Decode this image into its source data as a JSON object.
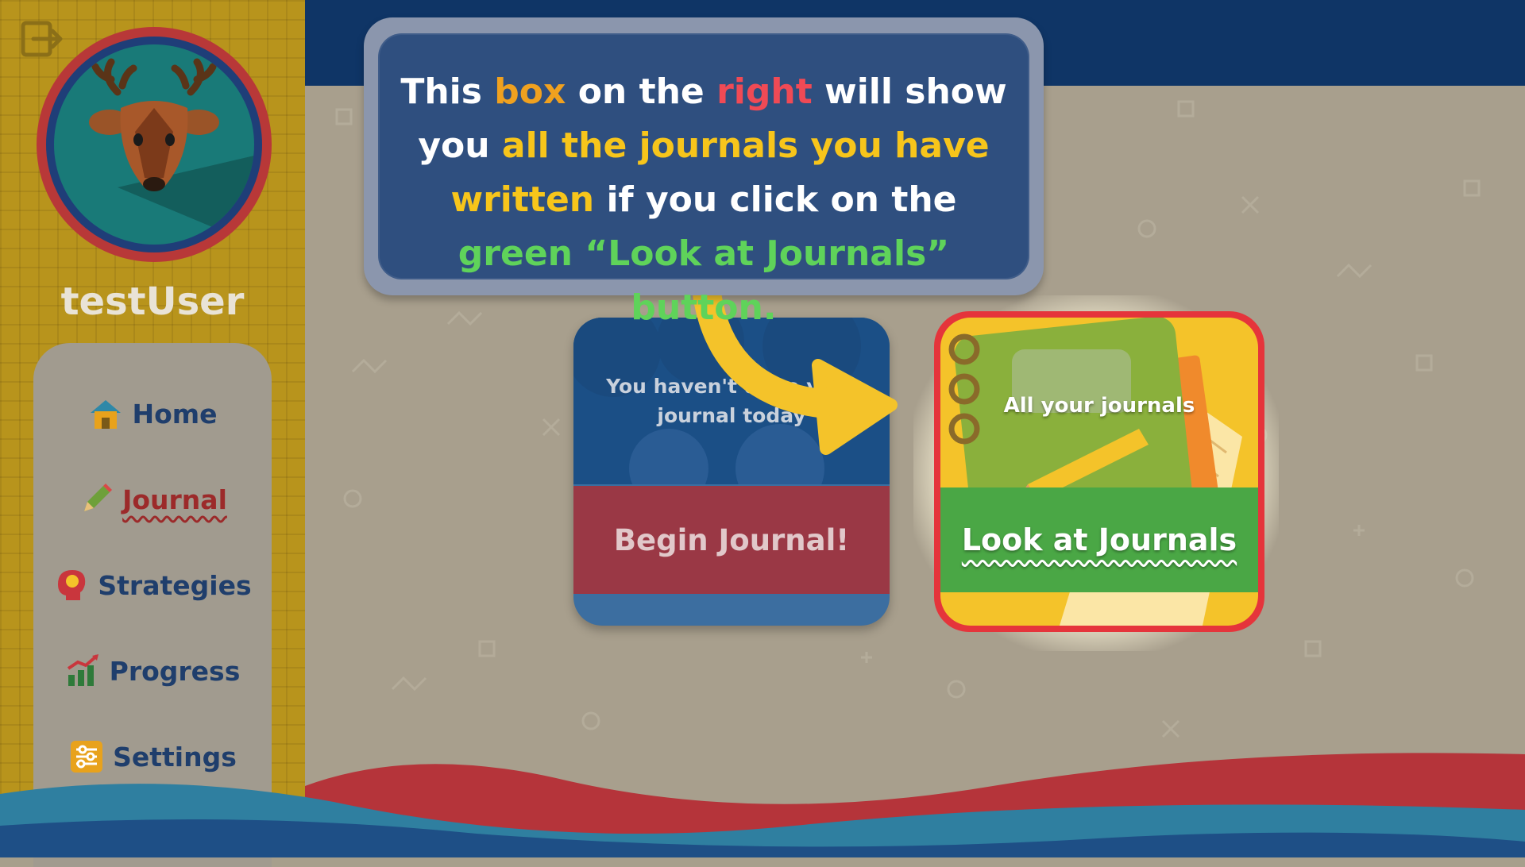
{
  "sidebar": {
    "username": "testUser",
    "items": [
      {
        "label": "Home",
        "icon": "home-icon",
        "active": false
      },
      {
        "label": "Journal",
        "icon": "pencil-icon",
        "active": true
      },
      {
        "label": "Strategies",
        "icon": "head-lightbulb-icon",
        "active": false
      },
      {
        "label": "Progress",
        "icon": "chart-icon",
        "active": false
      },
      {
        "label": "Settings",
        "icon": "sliders-icon",
        "active": false
      }
    ]
  },
  "callout": {
    "parts": [
      "This ",
      "box",
      " on the ",
      "right",
      " will show you ",
      "all the journals you have written",
      " if you click on the ",
      "green",
      " ",
      "“Look at Journals” button."
    ]
  },
  "tiles": {
    "begin": {
      "message": "You haven't done your journal today",
      "button": "Begin Journal!"
    },
    "look": {
      "caption": "All your journals",
      "button": "Look at Journals"
    }
  },
  "colors": {
    "topbar": "#0f3566",
    "sidebar": "#b8941c",
    "callout": "#2f4f7f",
    "highlight_border": "#e5343b",
    "green_band": "#4aa745"
  }
}
